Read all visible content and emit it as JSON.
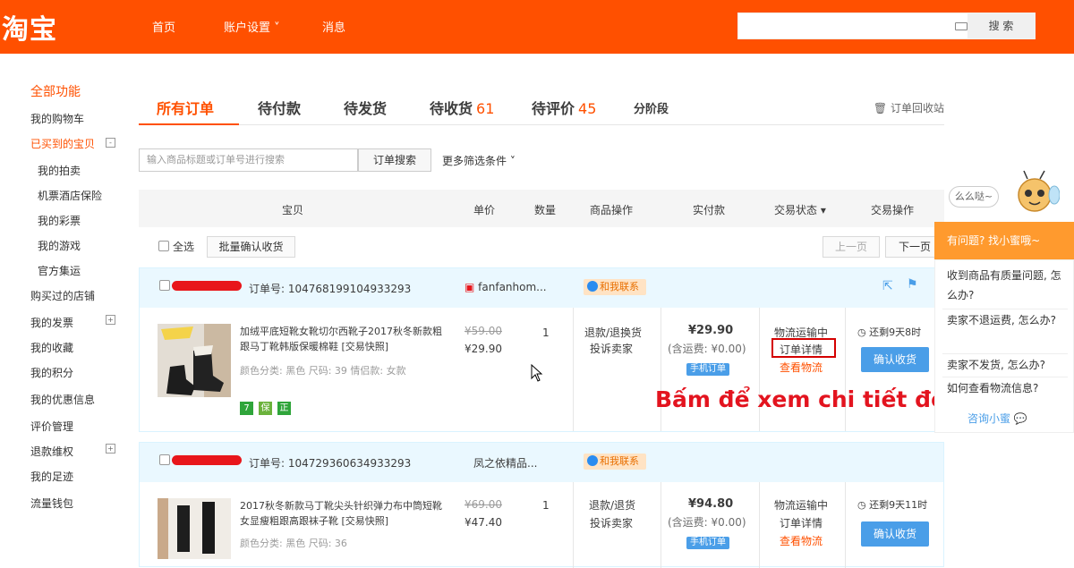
{
  "topbar": {
    "logo": "淘宝",
    "nav": [
      "首页",
      "账户设置 ˅",
      "消息"
    ],
    "search_button": "搜 索"
  },
  "sidebar": {
    "title": "全部功能",
    "items": [
      "我的购物车",
      "已买到的宝贝",
      "我的拍卖",
      "机票酒店保险",
      "我的彩票",
      "我的游戏",
      "官方集运",
      "购买过的店铺",
      "我的发票",
      "我的收藏",
      "我的积分",
      "我的优惠信息",
      "评价管理",
      "退款维权",
      "我的足迹",
      "流量钱包"
    ],
    "toggle_minus": "-",
    "toggle_plus": "+"
  },
  "tabs": {
    "items": [
      {
        "label": "所有订单",
        "count": ""
      },
      {
        "label": "待付款",
        "count": ""
      },
      {
        "label": "待发货",
        "count": ""
      },
      {
        "label": "待收货",
        "count": "61"
      },
      {
        "label": "待评价",
        "count": "45"
      },
      {
        "label": "分阶段",
        "count": ""
      }
    ],
    "recycle": "订单回收站"
  },
  "filter": {
    "placeholder": "输入商品标题或订单号进行搜索",
    "button": "订单搜索",
    "more": "更多筛选条件 ˅"
  },
  "table_head": [
    "宝贝",
    "单价",
    "数量",
    "商品操作",
    "实付款",
    "交易状态 ▾",
    "交易操作"
  ],
  "bulk": {
    "select_all": "全选",
    "confirm_batch": "批量确认收货",
    "prev": "上一页",
    "next": "下一页"
  },
  "orders": [
    {
      "order_no": "订单号: 104768199104933293",
      "shop": "fanfanhom...",
      "contact": "和我联系",
      "title": "加绒平底短靴女靴切尔西靴子2017秋冬新款粗跟马丁靴韩版保暖棉鞋 [交易快照]",
      "attrs": "颜色分类: 黑色  尺码: 39  情侣款: 女款",
      "orig_price": "¥59.00",
      "price": "¥29.90",
      "qty": "1",
      "ops": [
        "退款/退换货",
        "投诉卖家"
      ],
      "paid": "¥29.90",
      "shipping": "(含运费: ¥0.00)",
      "mobile": "手机订单",
      "status": [
        "物流运输中",
        "订单详情",
        "查看物流"
      ],
      "remain": "还剩9天8时",
      "confirm": "确认收货",
      "tags": [
        "7",
        "保",
        "正"
      ]
    },
    {
      "order_no": "订单号: 104729360634933293",
      "shop": "凤之依精品...",
      "contact": "和我联系",
      "title": "2017秋冬新款马丁靴尖头针织弹力布中筒短靴女显瘦粗跟高跟袜子靴 [交易快照]",
      "attrs": "颜色分类: 黑色  尺码: 36",
      "orig_price": "¥69.00",
      "price": "¥47.40",
      "qty": "1",
      "ops": [
        "退款/退货",
        "投诉卖家"
      ],
      "paid": "¥94.80",
      "shipping": "(含运费: ¥0.00)",
      "mobile": "手机订单",
      "status": [
        "物流运输中",
        "订单详情",
        "查看物流"
      ],
      "remain": "还剩9天11时",
      "confirm": "确认收货"
    }
  ],
  "annotation": "Bấm để xem chi tiết đơn hàng",
  "helper": {
    "bubble": "么么哒~",
    "header": "有问题? 找小蜜哦~",
    "questions": [
      "收到商品有质量问题, 怎么办?",
      "卖家不退运费, 怎么办?",
      "卖家不发货, 怎么办?",
      "如何查看物流信息?"
    ],
    "ask": "咨询小蜜"
  },
  "colors": {
    "brand": "#ff5000",
    "annotation": "#e3141f",
    "link_blue": "#4a9ee8"
  }
}
